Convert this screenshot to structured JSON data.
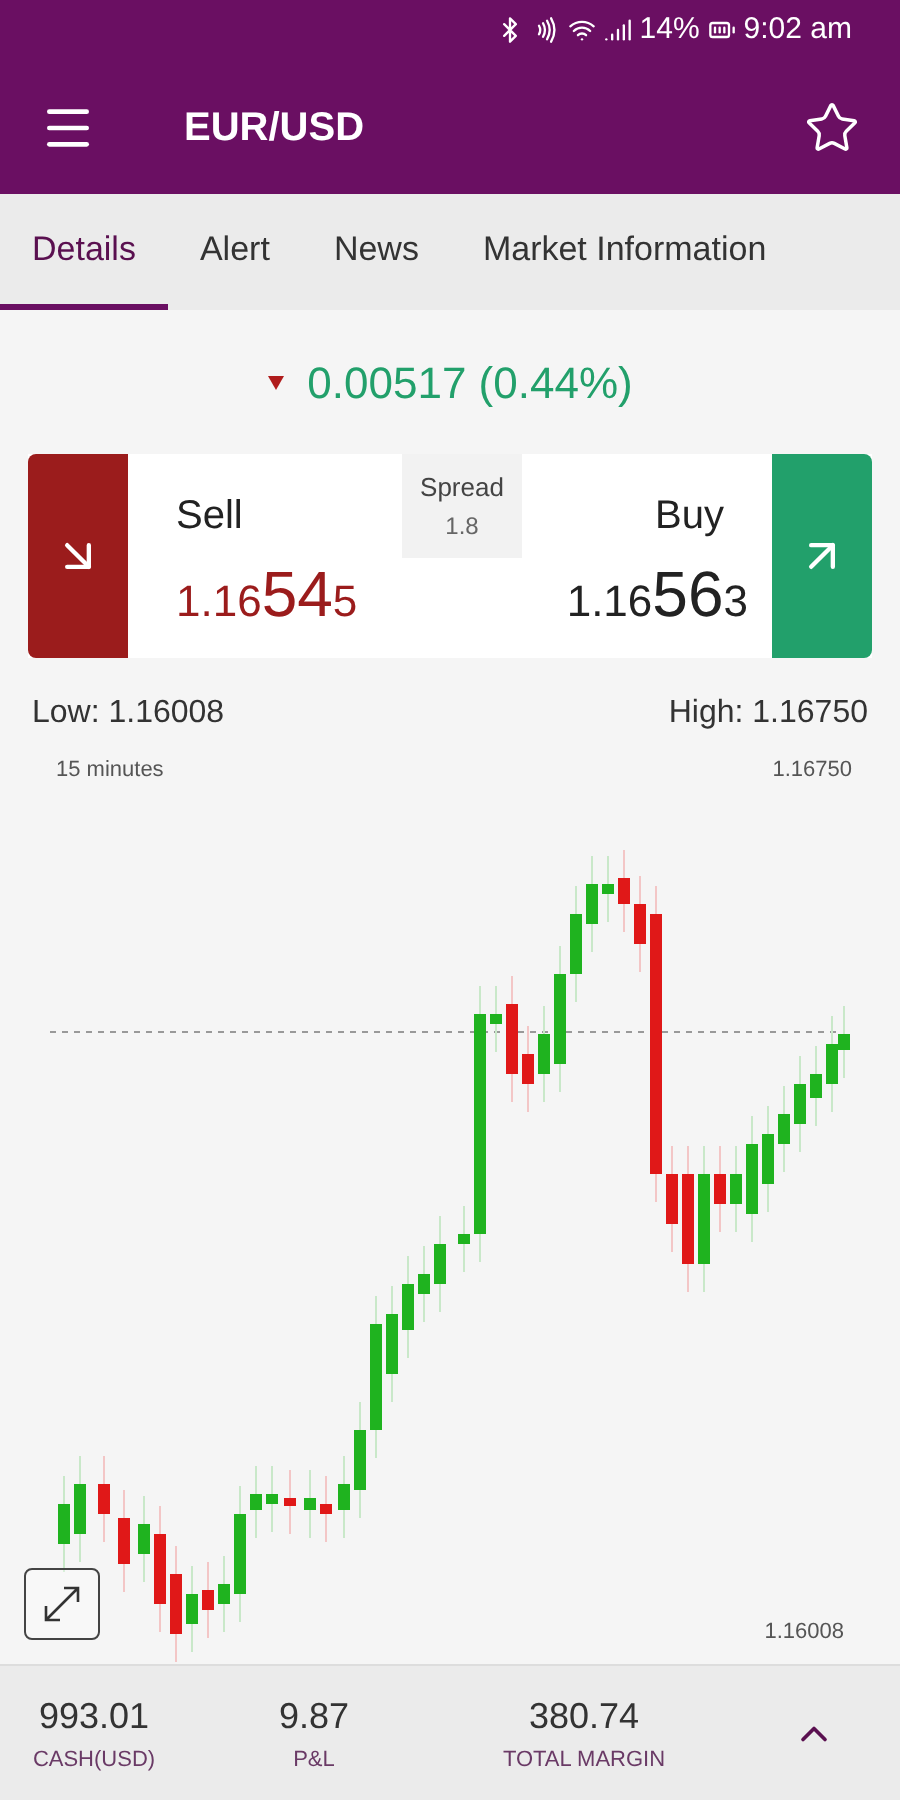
{
  "status_bar": {
    "battery": "14%",
    "time": "9:02 am"
  },
  "app_bar": {
    "title": "EUR/USD",
    "favorite": false
  },
  "tabs": [
    {
      "label": "Details",
      "selected": true
    },
    {
      "label": "Alert",
      "selected": false
    },
    {
      "label": "News",
      "selected": false
    },
    {
      "label": "Market Information",
      "selected": false
    }
  ],
  "change": {
    "falling": true,
    "text": "0.00517 (0.44%)"
  },
  "trade": {
    "sell": {
      "label": "Sell",
      "prefix": "1.16",
      "pips": "54",
      "fraction": "5"
    },
    "spread": {
      "label": "Spread",
      "value": "1.8"
    },
    "buy": {
      "label": "Buy",
      "prefix": "1.16",
      "pips": "56",
      "fraction": "3"
    }
  },
  "range": {
    "low": "Low: 1.16008",
    "high": "High: 1.16750"
  },
  "chart": {
    "interval": "15 minutes",
    "high_marker": "1.16750",
    "low_marker": "1.16008"
  },
  "footer": [
    {
      "value": "993.01",
      "label": "CASH(USD)"
    },
    {
      "value": "9.87",
      "label": "P&L"
    },
    {
      "value": "380.74",
      "label": "TOTAL MARGIN"
    }
  ]
}
